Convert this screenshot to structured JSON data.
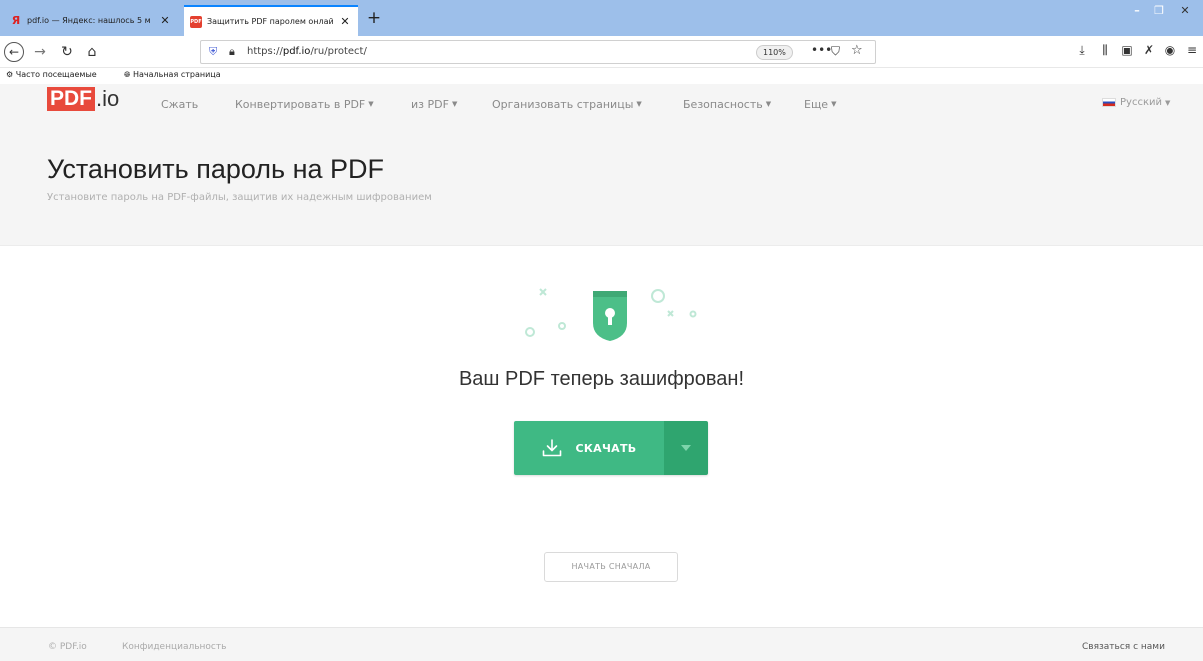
{
  "browser": {
    "tabs": [
      {
        "title": "pdf.io — Яндекс: нашлось 5 м",
        "close": "✕",
        "favicon": "Я"
      },
      {
        "title": "Защитить PDF паролем онлай",
        "close": "✕",
        "favicon": "PDF"
      }
    ],
    "new_tab": "+",
    "window_controls": {
      "minimize": "–",
      "maximize": "❐",
      "close": "✕"
    },
    "url": "https://pdf.io/ru/protect/",
    "url_prefix": "https://",
    "url_host": "pdf.io",
    "url_path": "/ru/protect/",
    "zoom": "110%",
    "page_actions": {
      "more": "•••",
      "pocket": "⛉",
      "bookmark": "☆"
    },
    "bookmarks": [
      {
        "icon": "gear-icon",
        "label": "Часто посещаемые"
      },
      {
        "icon": "globe-icon",
        "label": "Начальная страница"
      }
    ]
  },
  "site": {
    "logo": {
      "mark": "PDF",
      "suffix": ".io"
    },
    "nav": [
      {
        "label": "Сжать",
        "dropdown": false
      },
      {
        "label": "Конвертировать в PDF",
        "dropdown": true
      },
      {
        "label": "из PDF",
        "dropdown": true
      },
      {
        "label": "Организовать страницы",
        "dropdown": true
      },
      {
        "label": "Безопасность",
        "dropdown": true
      },
      {
        "label": "Еще",
        "dropdown": true
      }
    ],
    "language": "Русский",
    "title": "Установить пароль на PDF",
    "subtitle": "Установите пароль на PDF-файлы, защитив их надежным шифрованием",
    "result_title": "Ваш PDF теперь зашифрован!",
    "download_label": "СКАЧАТЬ",
    "restart_label": "НАЧАТЬ СНАЧАЛА",
    "footer": {
      "copyright": "© PDF.io",
      "privacy": "Конфиденциальность",
      "contact": "Связаться с нами"
    },
    "colors": {
      "brand_red": "#e84a3c",
      "accent_green": "#3fb984",
      "accent_green_dark": "#2fa56f"
    }
  }
}
